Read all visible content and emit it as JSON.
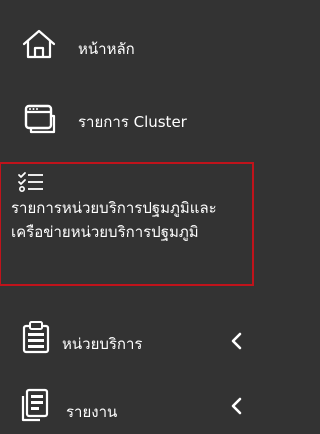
{
  "sidebar": {
    "items": [
      {
        "label": "หน้าหลัก",
        "icon": "home-icon"
      },
      {
        "label": "รายการ Cluster",
        "icon": "window-icon"
      },
      {
        "label": "รายการหน่วยบริการปฐมภูมิและเครือข่ายหน่วยบริการปฐมภูมิ",
        "icon": "checklist-icon",
        "active": true
      },
      {
        "label": "หน่วยบริการ",
        "icon": "clipboard-icon",
        "has_submenu": true
      },
      {
        "label": "รายงาน",
        "icon": "report-icon",
        "has_submenu": true
      }
    ]
  },
  "colors": {
    "background": "#333333",
    "text": "#ffffff",
    "active_border": "#c0131b"
  }
}
